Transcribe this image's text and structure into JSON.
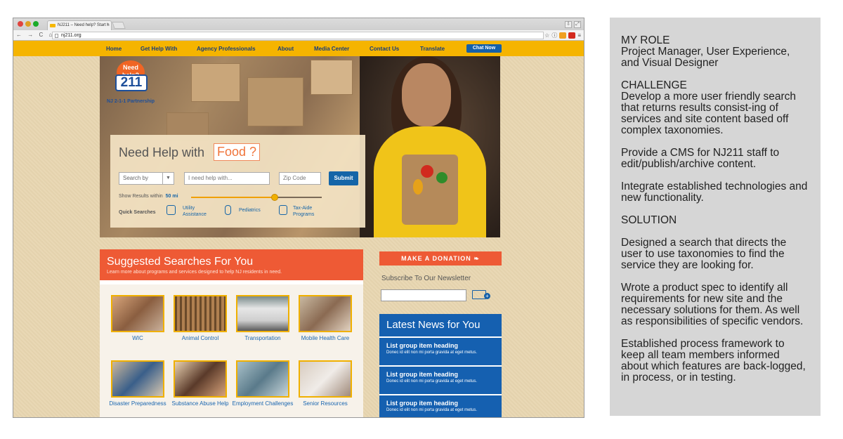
{
  "browser": {
    "tab_title": "NJ211 – Need help? Start h",
    "url": "nj211.org",
    "nav_icons": "← → C ⌂"
  },
  "site": {
    "nav": [
      "Home",
      "Get Help With",
      "Agency Professionals",
      "About",
      "Media Center",
      "Contact Us",
      "Translate"
    ],
    "chat_label": "Chat Now",
    "logo": {
      "bubble": "Need help?",
      "number": "211",
      "name": "NJ 2-1-1 Partnership"
    },
    "search": {
      "heading": "Need Help with",
      "heading_highlight": "Food ?",
      "select_label": "Search by",
      "help_placeholder": "I need help with...",
      "zip_placeholder": "Zip Code",
      "submit_label": "Submit",
      "show_results_label": "Show Results within",
      "distance": "50 mi",
      "slider_fraction": 0.64,
      "quick_searches_label": "Quick Searches",
      "quick_searches": [
        "Utility Assistance",
        "Pediatrics",
        "Tax-Aide Programs"
      ]
    },
    "suggested": {
      "title": "Suggested Searches For You",
      "subtitle": "Learn more about programs and services designed to help NJ residents in need.",
      "items": [
        "WIC",
        "Animal Control",
        "Transportation",
        "Mobile Health Care",
        "Disaster Preparedness",
        "Substance Abuse Help",
        "Employment Challenges",
        "Senior Resources"
      ]
    },
    "donate_label": "MAKE A DONATION",
    "newsletter_label": "Subscribe To Our Newsletter",
    "news": {
      "title": "Latest News for You",
      "items": [
        {
          "heading": "List group item heading",
          "text": "Donec id elit non mi porta gravida at eget metus."
        },
        {
          "heading": "List group item heading",
          "text": "Donec id elit non mi porta gravida at eget metus."
        },
        {
          "heading": "List group item heading",
          "text": "Donec id elit non mi porta gravida at eget metus."
        }
      ]
    }
  },
  "side": {
    "role_heading": "MY ROLE",
    "role_text": "Project Manager, User Experience, and Visual Designer",
    "challenge_heading": "CHALLENGE",
    "challenge_1": "Develop a more user friendly search that returns results consist-ing of services and site content based off complex taxonomies.",
    "challenge_2": "Provide a CMS for NJ211 staff to edit/publish/archive content.",
    "challenge_3": "Integrate established technologies and new functionality.",
    "solution_heading": "SOLUTION",
    "solution_1": "Designed a search that directs the user to use taxonomies to find the service they are looking for.",
    "solution_2": "Wrote a product spec to identify all requirements for new site and the necessary solutions for them. As well as responsibilities of specific vendors.",
    "solution_3": "Established process framework to keep all team members informed about which features are back-logged, in process, or in testing."
  }
}
